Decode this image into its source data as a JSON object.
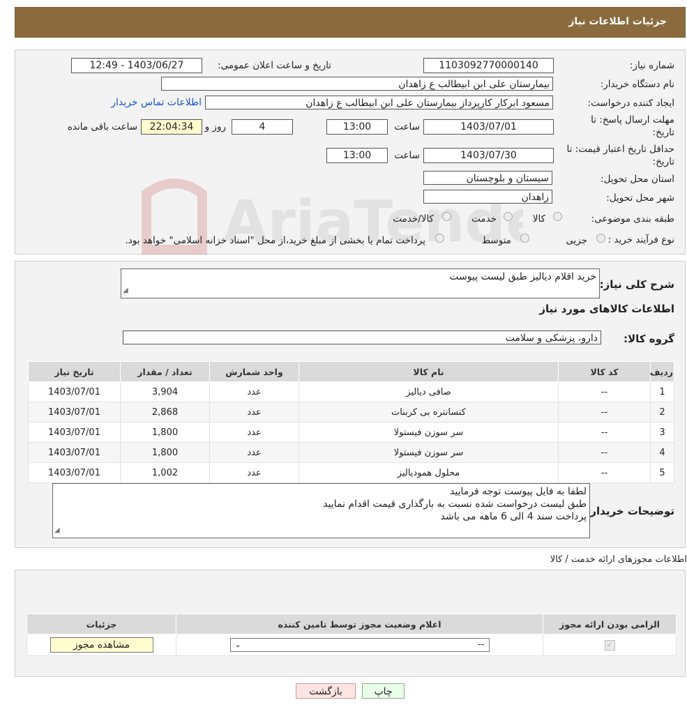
{
  "header": {
    "title": "جزئیات اطلاعات نیاز"
  },
  "info": {
    "need_number_label": "شماره نیاز:",
    "need_number": "1103092770000140",
    "announce_label": "تاریخ و ساعت اعلان عمومی:",
    "announce_value": "1403/06/27 - 12:49",
    "buyer_org_label": "نام دستگاه خریدار:",
    "buyer_org": "بیمارستان علی ابن ابیطالب  ع  زاهدان",
    "creator_label": "ایجاد کننده درخواست:",
    "creator": "مسعود ابرکار کارپرداز بیمارستان علی ابن ابیطالب  ع  زاهدان",
    "contact_link": "اطلاعات تماس خریدار",
    "deadline_label_1": "مهلت ارسال پاسخ: تا",
    "deadline_label_2": "تاریخ:",
    "deadline_date": "1403/07/01",
    "time_word": "ساعت",
    "deadline_time": "13:00",
    "days": "4",
    "days_word": "روز و",
    "remaining": "22:04:34",
    "remaining_word": "ساعت باقی مانده",
    "validity_label_1": "حداقل تاریخ اعتبار قیمت: تا",
    "validity_label_2": "تاریخ:",
    "validity_date": "1403/07/30",
    "validity_time": "13:00",
    "province_label": "استان محل تحویل:",
    "province": "سیستان و بلوچستان",
    "city_label": "شهر محل تحویل:",
    "city": "زاهدان",
    "category_label": "طبقه بندی موضوعی:",
    "cat_goods": "کالا",
    "cat_service": "خدمت",
    "cat_goods_service": "کالا/خدمت",
    "process_label": "نوع فرآیند خرید :",
    "proc_partial": "جزیی",
    "proc_medium": "متوسط",
    "payment_note": "پرداخت تمام یا بخشی از مبلغ خرید،از محل \"اسناد خزانه اسلامی\" خواهد بود."
  },
  "watermark": {
    "text": "AriaTender.neT"
  },
  "summary": {
    "desc_label": "شرح کلی نیاز:",
    "desc_value": "خرید اقلام دیالیز طبق لیست پیوست",
    "goods_info_title": "اطلاعات کالاهای مورد نیاز",
    "group_label": "گروه کالا:",
    "group_value": "دارو، پزشکی و سلامت"
  },
  "items_table": {
    "headers": [
      "ردیف",
      "کد کالا",
      "نام کالا",
      "واحد شمارش",
      "تعداد / مقدار",
      "تاریخ نیاز"
    ],
    "rows": [
      [
        "1",
        "--",
        "صافی دیالیز",
        "عدد",
        "3,904",
        "1403/07/01"
      ],
      [
        "2",
        "--",
        "کنسانتره بی کربنات",
        "عدد",
        "2,868",
        "1403/07/01"
      ],
      [
        "3",
        "--",
        "سر سوزن فیستولا",
        "عدد",
        "1,800",
        "1403/07/01"
      ],
      [
        "4",
        "--",
        "سر سوزن فیستولا",
        "عدد",
        "1,800",
        "1403/07/01"
      ],
      [
        "5",
        "--",
        "محلول همودیالیز",
        "عدد",
        "1,002",
        "1403/07/01"
      ]
    ]
  },
  "buyer_notes": {
    "label": "توضیحات خریدار:",
    "lines": [
      "لطفا به فایل پیوست توجه فرمایید",
      "طبق لیست درخواست شده نسبت به بارگذاری قیمت اقدام نمایید",
      "پرداخت سند 4 الی 6 ماهه می باشد"
    ]
  },
  "permits": {
    "title": "اطلاعات مجوزهای ارائه خدمت / کالا",
    "headers": [
      "الزامی بودن ارائه مجوز",
      "اعلام وضعیت مجوز توسط تامین کننده",
      "جزئیات"
    ],
    "select_value": "--",
    "view_button": "مشاهده مجوز"
  },
  "footer": {
    "print_button": "چاپ",
    "back_button": "بازگشت"
  }
}
